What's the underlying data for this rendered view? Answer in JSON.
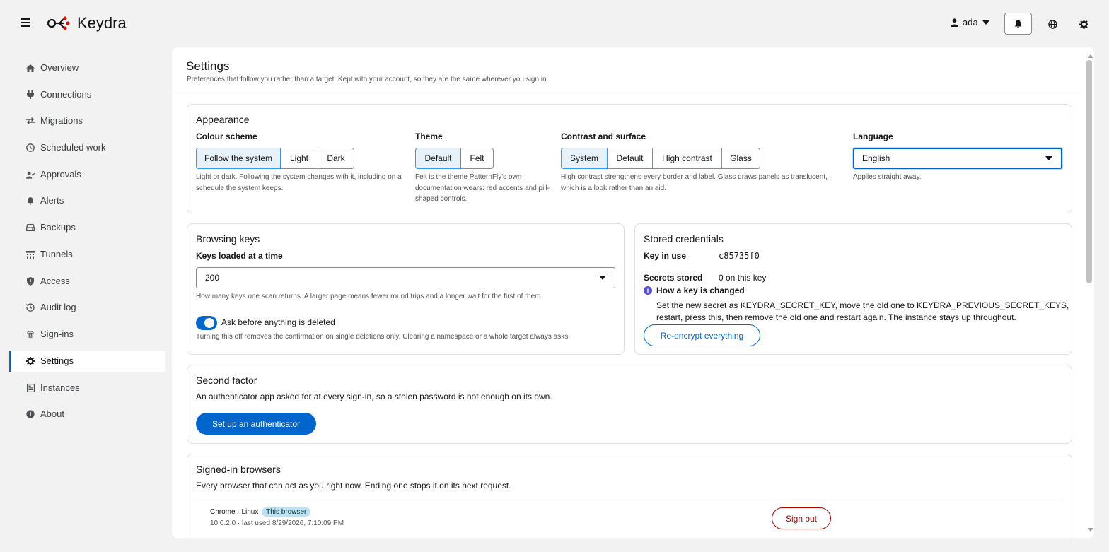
{
  "app": {
    "name": "Keydra"
  },
  "header": {
    "user": "ada"
  },
  "sidebar": {
    "items": [
      {
        "label": "Overview",
        "icon": "home-icon"
      },
      {
        "label": "Connections",
        "icon": "plug-icon"
      },
      {
        "label": "Migrations",
        "icon": "exchange-icon"
      },
      {
        "label": "Scheduled work",
        "icon": "clock-icon"
      },
      {
        "label": "Approvals",
        "icon": "user-check-icon"
      },
      {
        "label": "Alerts",
        "icon": "bell-icon"
      },
      {
        "label": "Backups",
        "icon": "hdd-icon"
      },
      {
        "label": "Tunnels",
        "icon": "network-icon"
      },
      {
        "label": "Access",
        "icon": "shield-icon"
      },
      {
        "label": "Audit log",
        "icon": "history-icon"
      },
      {
        "label": "Sign-ins",
        "icon": "fingerprint-icon"
      },
      {
        "label": "Settings",
        "icon": "gear-icon",
        "active": true
      },
      {
        "label": "Instances",
        "icon": "server-icon"
      },
      {
        "label": "About",
        "icon": "info-icon"
      }
    ]
  },
  "page": {
    "title": "Settings",
    "subtitle": "Preferences that follow you rather than a target. Kept with your account, so they are the same wherever you sign in."
  },
  "appearance": {
    "title": "Appearance",
    "colour_scheme": {
      "label": "Colour scheme",
      "options": [
        "Follow the system",
        "Light",
        "Dark"
      ],
      "selected": "Follow the system",
      "helper": "Light or dark. Following the system changes with it, including on a schedule the system keeps."
    },
    "theme": {
      "label": "Theme",
      "options": [
        "Default",
        "Felt"
      ],
      "selected": "Default",
      "helper": "Felt is the theme PatternFly's own documentation wears: red accents and pill-shaped controls."
    },
    "contrast": {
      "label": "Contrast and surface",
      "options": [
        "System",
        "Default",
        "High contrast",
        "Glass"
      ],
      "selected": "System",
      "helper": "High contrast strengthens every border and label. Glass draws panels as translucent, which is a look rather than an aid."
    },
    "language": {
      "label": "Language",
      "value": "English",
      "helper": "Applies straight away."
    }
  },
  "browsing": {
    "title": "Browsing keys",
    "keys_label": "Keys loaded at a time",
    "keys_value": "200",
    "keys_helper": "How many keys one scan returns. A larger page means fewer round trips and a longer wait for the first of them.",
    "confirm_label": "Ask before anything is deleted",
    "confirm_on": true,
    "confirm_helper": "Turning this off removes the confirmation on single deletions only. Clearing a namespace or a whole target always asks."
  },
  "credentials": {
    "title": "Stored credentials",
    "key_in_use_label": "Key in use",
    "key_in_use_value": "c85735f0",
    "secrets_label": "Secrets stored",
    "secrets_value": "0 on this key",
    "info_title": "How a key is changed",
    "info_text_1": "Set the new secret as KEYDRA_SECRET_KEY, move the old one to KEYDRA_PREVIOUS_SECRET_KEYS,",
    "info_text_2": "restart, press this, then remove the old one and restart again. The instance stays up throughout.",
    "button": "Re-encrypt everything"
  },
  "second_factor": {
    "title": "Second factor",
    "text": "An authenticator app asked for at every sign-in, so a stolen password is not enough on its own.",
    "button": "Set up an authenticator"
  },
  "browsers": {
    "title": "Signed-in browsers",
    "text": "Every browser that can act as you right now. Ending one stops it on its next request.",
    "rows": [
      {
        "name": "Chrome · Linux",
        "badge": "This browser",
        "detail": "10.0.2.0 · last used 8/29/2026, 7:10:09 PM",
        "action": "Sign out"
      }
    ]
  }
}
